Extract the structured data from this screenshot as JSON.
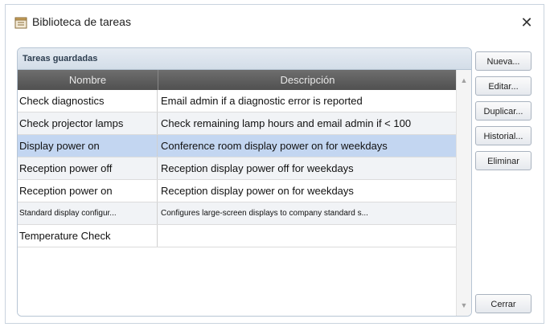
{
  "window": {
    "title": "Biblioteca de tareas",
    "close_glyph": "✕"
  },
  "group": {
    "title": "Tareas guardadas"
  },
  "table": {
    "columns": [
      "Nombre",
      "Descripción"
    ],
    "rows": [
      {
        "name": "Check diagnostics",
        "description": "Email admin if a diagnostic error is reported"
      },
      {
        "name": "Check projector lamps",
        "description": "Check remaining lamp hours and email admin if < 100"
      },
      {
        "name": "Display power on",
        "description": "Conference room display power on for weekdays"
      },
      {
        "name": "Reception power off",
        "description": "Reception display power off for weekdays"
      },
      {
        "name": "Reception power on",
        "description": "Reception display power on for weekdays"
      },
      {
        "name": "Standard display configur...",
        "description": "Configures large-screen displays to company standard s..."
      },
      {
        "name": "Temperature Check",
        "description": ""
      }
    ],
    "selected_index": 2
  },
  "buttons": {
    "new": "Nueva...",
    "edit": "Editar...",
    "duplicate": "Duplicar...",
    "history": "Historial...",
    "delete": "Eliminar",
    "close": "Cerrar"
  },
  "icons": {
    "app": "task-library-icon",
    "scroll_up": "▲",
    "scroll_down": "▼"
  },
  "colors": {
    "selected_row": "#c3d6f1",
    "header_bg": "#5e5e5e",
    "group_border": "#b7c5d4"
  }
}
